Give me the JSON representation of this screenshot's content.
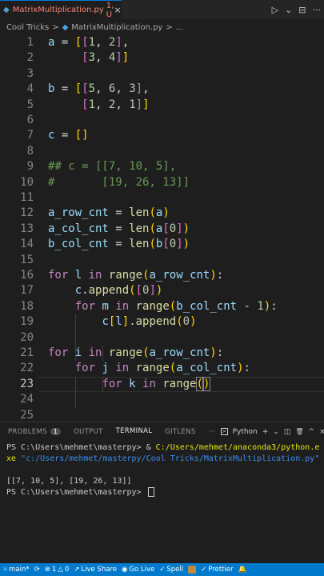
{
  "tab": {
    "filename": "MatrixMultiplication.py",
    "status": "1, U",
    "close": "×"
  },
  "tab_actions": {
    "run": "▷",
    "run_dropdown": "⌄",
    "split": "⊟",
    "more": "···"
  },
  "breadcrumb": {
    "folder": "Cool Tricks",
    "sep1": ">",
    "file": "MatrixMultiplication.py",
    "sep2": ">",
    "more": "..."
  },
  "editor": {
    "current_line": 23,
    "lines": [
      "1",
      "2",
      "3",
      "4",
      "5",
      "6",
      "7",
      "8",
      "9",
      "10",
      "11",
      "12",
      "13",
      "14",
      "15",
      "16",
      "17",
      "18",
      "19",
      "20",
      "21",
      "22",
      "23",
      "24",
      "25"
    ]
  },
  "panel": {
    "tabs": [
      "PROBLEMS",
      "OUTPUT",
      "TERMINAL",
      "GITLENS"
    ],
    "problems_count": "1",
    "more": "···",
    "shell": "Python",
    "add": "+",
    "dropdown": "⌄",
    "trash": "🗑",
    "chevron": "^",
    "close": "×"
  },
  "terminal": {
    "line1_prefix": "PS C:\\Users\\mehmet\\masterpy> ",
    "line1_amp": "& ",
    "line1_cmd": "C:/Users/mehmet/anaconda3/python.e",
    "line2_cmd": "xe",
    "line2_arg": " \"c:/Users/mehmet/masterpy/Cool Tricks/MatrixMultiplication.py\"",
    "output": "[[7, 10, 5], [19, 26, 13]]",
    "prompt": "PS C:\\Users\\mehmet\\masterpy> "
  },
  "statusbar": {
    "branch": "main*",
    "sync": "⟳",
    "errors": "1",
    "warnings": "0",
    "live_share": "Live Share",
    "go_live": "Go Live",
    "spell": "Spell",
    "prettier": "Prettier",
    "bell": "🔔"
  },
  "colors": {
    "accent": "#007acc",
    "keyword": "#c586c0",
    "variable": "#9cdcfe",
    "function": "#dcdcaa",
    "number": "#b5cea8",
    "comment": "#6a9955"
  }
}
